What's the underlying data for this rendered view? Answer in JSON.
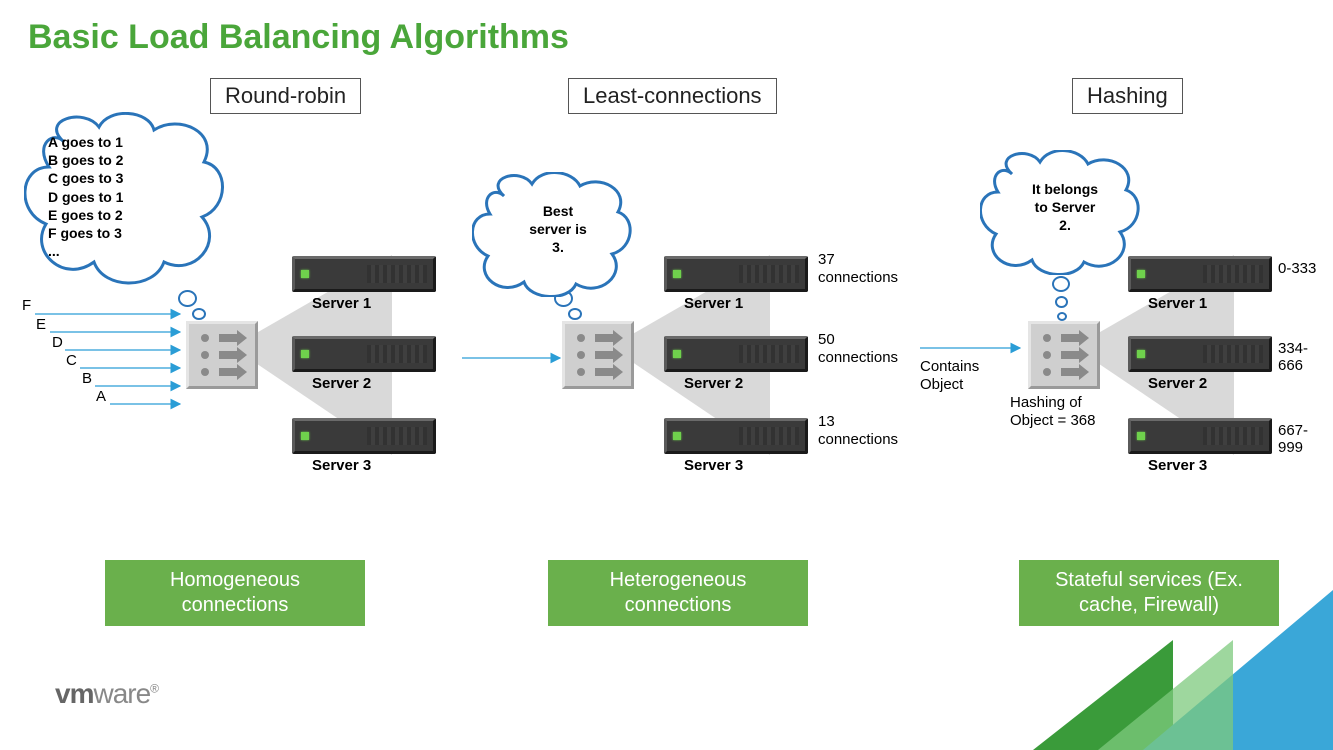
{
  "title": "Basic Load Balancing Algorithms",
  "columns": {
    "rr": {
      "label": "Round-robin",
      "badge": "Homogeneous connections",
      "cloud": [
        "A goes to 1",
        "B goes to 2",
        "C goes to 3",
        "D goes to 1",
        "E goes to 2",
        "F goes to 3",
        "..."
      ],
      "arrows": [
        "F",
        "E",
        "D",
        "C",
        "B",
        "A"
      ],
      "servers": [
        {
          "name": "Server 1"
        },
        {
          "name": "Server 2"
        },
        {
          "name": "Server 3"
        }
      ]
    },
    "lc": {
      "label": "Least-connections",
      "badge": "Heterogeneous connections",
      "cloud": [
        "Best",
        "server is",
        "3."
      ],
      "servers": [
        {
          "name": "Server 1",
          "meta1": "37",
          "meta2": "connections"
        },
        {
          "name": "Server 2",
          "meta1": "50",
          "meta2": "connections"
        },
        {
          "name": "Server 3",
          "meta1": "13",
          "meta2": "connections"
        }
      ]
    },
    "hs": {
      "label": "Hashing",
      "badge": "Stateful services (Ex. cache, Firewall)",
      "cloud": [
        "It belongs",
        "to Server",
        "2."
      ],
      "request_label1": "Contains",
      "request_label2": "Object",
      "hash_label1": "Hashing of",
      "hash_label2": "Object = 368",
      "servers": [
        {
          "name": "Server 1",
          "range": "0-333"
        },
        {
          "name": "Server 2",
          "range": "334-666"
        },
        {
          "name": "Server 3",
          "range": "667-999"
        }
      ]
    }
  },
  "logo": "vmware"
}
